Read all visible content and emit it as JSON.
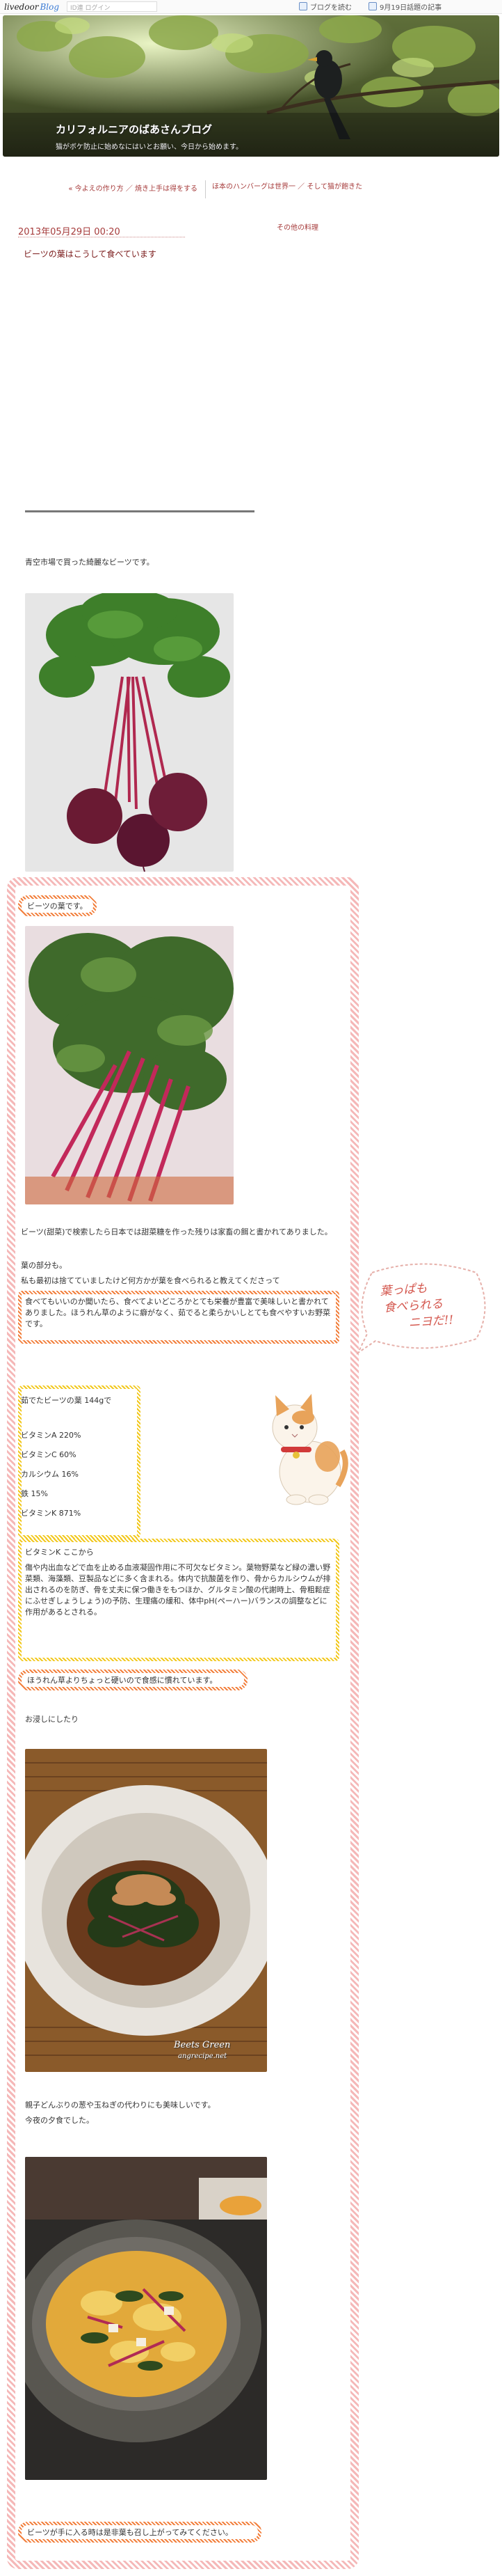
{
  "topbar": {
    "logo": "livedoor",
    "logo_blog": "Blog",
    "search_hint": "ID連 ログイン",
    "follow": "ブログを読む",
    "calendar": "9月19日話題の記事"
  },
  "header": {
    "title": "カリフォルニアのばあさんブログ",
    "description": "猫がボケ防止に始めなにはいとお願い、今日から始めます。"
  },
  "pager": {
    "prev": "« 今よえの作り方 ／ 焼き上手は得をする",
    "next": "ほ本のハンバーグは世界一 ／ そして猫が飽きた"
  },
  "post": {
    "date": "2013年05月29日 00:20",
    "other_link": "その他の料理",
    "title": "ビーツの葉はこうして食べています",
    "intro": "青空市場で買った綺麗なビーツです。",
    "pill1": "ビーツの葉です。",
    "body1": [
      "ビーツ(甜菜)で検索したら日本では甜菜糖を作った残りは家畜の餌と書かれてありました。",
      "葉の部分も。",
      "私も最初は捨てていましたけど何方かが葉を食べられると教えてくださって"
    ],
    "body_box": "食べてもいいのか聞いたら、食べてよいどころかとても栄養が豊富で美味しいと書かれてありました。ほうれん草のように癖がなく、茹でると柔らかいしとても食べやすいお野菜です。",
    "nutrition_title": "茹でたビーツの葉 144gで",
    "nutrition": [
      "ビタミンA 220%",
      "ビタミンC 60%",
      "カルシウム 16%",
      "鉄 15%",
      "ビタミンK 871%"
    ],
    "vitk_title": "ビタミンK ここから",
    "vitk_body": "傷や内出血などで血を止める血液凝固作用に不可欠なビタミン。葉物野菜など緑の濃い野菜類、海藻類、豆製品などに多く含まれる。体内で抗酸菌を作り、骨からカルシウムが排出されるのを防ぎ、骨を丈夫に保つ働きをもつほか、グルタミン酸の代謝時上、骨粗鬆症にふせぎしょうしょう)の予防、生理痛の緩和、体中pH(ペーハー)バランスの調整などに作用があるとされる。",
    "pill2": "ほうれん草よりちょっと硬いので食感に慣れています。",
    "ohitashi": "お浸しにしたり",
    "photo1_watermark": "Beets Green",
    "photo1_watermark2": "angrecipe.net",
    "oyako": "親子どんぶりの葱や玉ねぎの代わりにも美味しいです。",
    "today": "今夜の夕食でした。",
    "pill3": "ビーツが手に入る時は是非葉も召し上がってみてください。",
    "balloon": [
      "葉っぱも",
      "食べられる",
      "ニヨだ!!"
    ]
  },
  "colors": {
    "accent": "#a63b3b",
    "red_stripe": "#f5b8b8",
    "orange_stripe": "#f27f3c",
    "yellow_stripe": "#f2c81d"
  }
}
